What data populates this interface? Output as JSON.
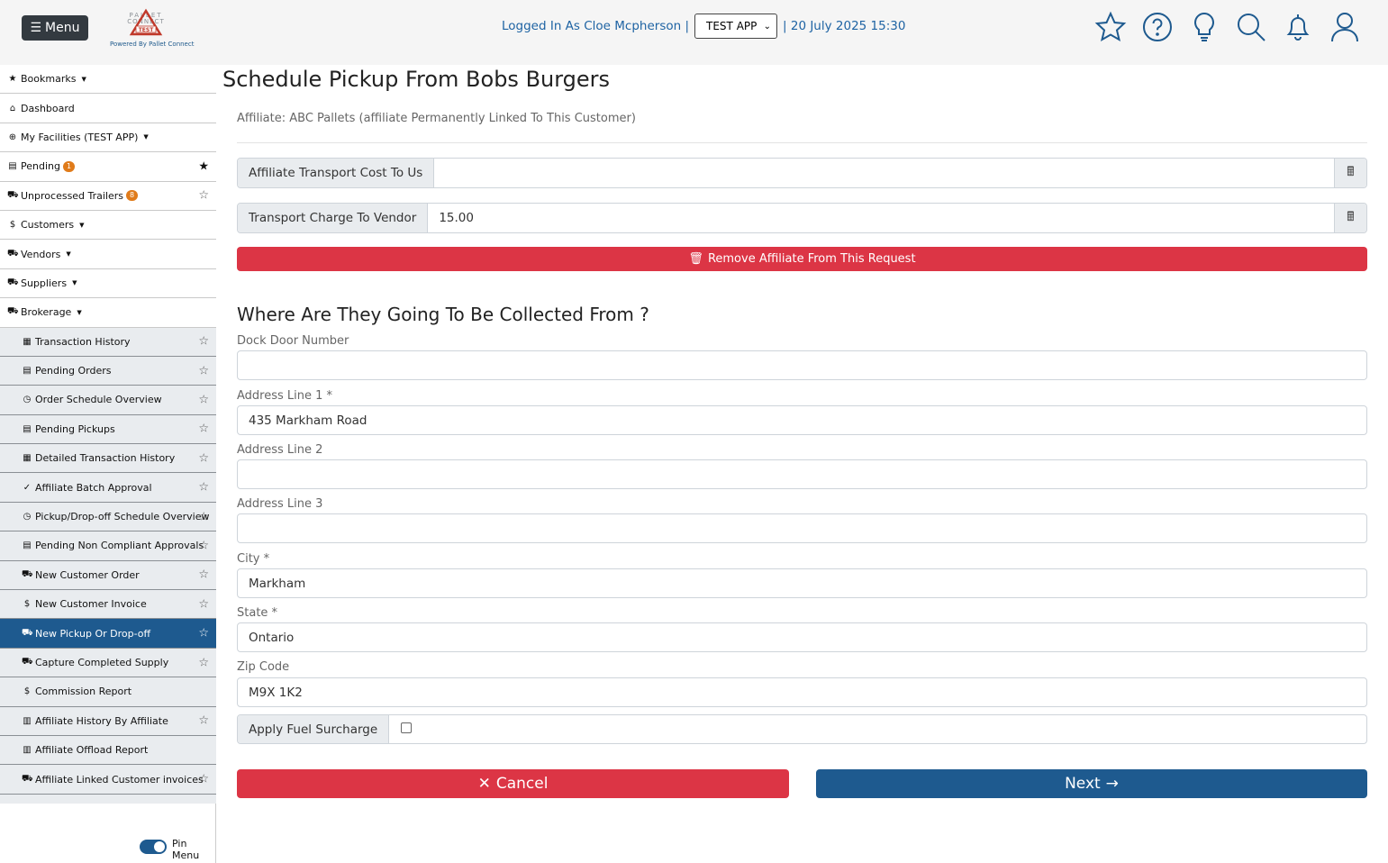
{
  "header": {
    "menu_label": "Menu",
    "logo_caption": "Powered By Pallet Connect",
    "logged_in_text": "Logged In As Cloe Mcpherson |",
    "app_selected": "TEST APP",
    "datetime_text": "| 20 July 2025 15:30",
    "icons": [
      "star-icon",
      "help-icon",
      "lightbulb-icon",
      "search-icon",
      "bell-icon",
      "user-icon"
    ]
  },
  "sidebar": {
    "items": [
      {
        "label": "Bookmarks",
        "icon": "★",
        "caret": true
      },
      {
        "label": "Dashboard",
        "icon": "⌂"
      },
      {
        "label": "My Facilities (TEST APP)",
        "icon": "⊕",
        "caret": true
      },
      {
        "label": "Pending",
        "icon": "▤",
        "badge": "1",
        "star": "★"
      },
      {
        "label": "Unprocessed Trailers",
        "icon": "⛟",
        "badge": "8",
        "star": "☆"
      },
      {
        "label": "Customers",
        "icon": "$",
        "caret": true
      },
      {
        "label": "Vendors",
        "icon": "⛟",
        "caret": true
      },
      {
        "label": "Suppliers",
        "icon": "⛟",
        "caret": true
      },
      {
        "label": "Brokerage",
        "icon": "⛟",
        "caret": true
      }
    ],
    "sub_items": [
      {
        "label": "Transaction History",
        "icon": "▦",
        "star": "☆"
      },
      {
        "label": "Pending Orders",
        "icon": "▤",
        "star": "☆"
      },
      {
        "label": "Order Schedule Overview",
        "icon": "◷",
        "star": "☆"
      },
      {
        "label": "Pending Pickups",
        "icon": "▤",
        "star": "☆"
      },
      {
        "label": "Detailed Transaction History",
        "icon": "▦",
        "star": "☆"
      },
      {
        "label": "Affiliate Batch Approval",
        "icon": "✓",
        "star": "☆"
      },
      {
        "label": "Pickup/Drop-off Schedule Overview",
        "icon": "◷",
        "star": "☆"
      },
      {
        "label": "Pending Non Compliant Approvals",
        "icon": "▤",
        "star": "☆"
      },
      {
        "label": "New Customer Order",
        "icon": "⛟",
        "star": "☆"
      },
      {
        "label": "New Customer Invoice",
        "icon": "$",
        "star": "☆"
      },
      {
        "label": "New Pickup Or Drop-off",
        "icon": "⛟",
        "star": "☆",
        "active": true
      },
      {
        "label": "Capture Completed Supply",
        "icon": "⛟",
        "star": "☆"
      },
      {
        "label": "Commission Report",
        "icon": "$",
        "star": ""
      },
      {
        "label": "Affiliate History By Affiliate",
        "icon": "▥",
        "star": "☆"
      },
      {
        "label": "Affiliate Offload Report",
        "icon": "▥",
        "star": ""
      },
      {
        "label": "Affiliate Linked Customer invoices",
        "icon": "⛟",
        "star": "☆"
      }
    ],
    "pin_menu_label": "Pin Menu"
  },
  "main": {
    "title": "Schedule Pickup From Bobs Burgers",
    "affiliate_note": "Affiliate: ABC Pallets (affiliate Permanently Linked To This Customer)",
    "transport_cost_label": "Affiliate Transport Cost To Us",
    "transport_cost_value": "",
    "transport_charge_label": "Transport Charge To Vendor",
    "transport_charge_value": "15.00",
    "remove_affiliate_label": "Remove Affiliate From This Request",
    "section_title": "Where Are They Going To Be Collected From ?",
    "fields": {
      "dock_door": {
        "label": "Dock Door Number",
        "value": ""
      },
      "address1": {
        "label": "Address Line 1 *",
        "value": "435 Markham Road"
      },
      "address2": {
        "label": "Address Line 2",
        "value": ""
      },
      "address3": {
        "label": "Address Line 3",
        "value": ""
      },
      "city": {
        "label": "City *",
        "value": "Markham"
      },
      "state": {
        "label": "State *",
        "value": "Ontario"
      },
      "zip": {
        "label": "Zip Code",
        "value": "M9X 1K2"
      }
    },
    "fuel_surcharge_label": "Apply Fuel Surcharge",
    "cancel_label": "Cancel",
    "next_label": "Next"
  },
  "colors": {
    "primary": "#1e5a8f",
    "danger": "#dc3545",
    "badge": "#e07b1a"
  }
}
